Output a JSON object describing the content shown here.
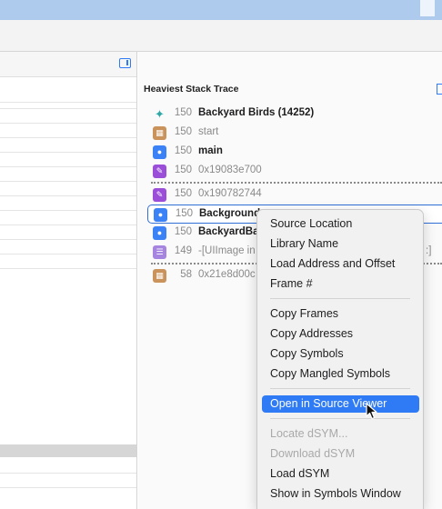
{
  "panel": {
    "title": "Heaviest Stack Trace"
  },
  "frames": [
    {
      "icon": "hummingbird-icon",
      "count": "150",
      "name": "Backyard Birds (14252)",
      "style": "bold"
    },
    {
      "icon": "library-icon",
      "count": "150",
      "name": "start",
      "style": "dim"
    },
    {
      "icon": "user-icon",
      "count": "150",
      "name": "main",
      "style": "bold"
    },
    {
      "icon": "purple-pen-icon",
      "count": "150",
      "name": "0x19083e700",
      "style": "dim"
    },
    {
      "icon": "purple-pen-icon",
      "count": "150",
      "name": "0x190782744",
      "style": "dim"
    },
    {
      "icon": "user-icon",
      "count": "150",
      "name": "Background",
      "style": "bold"
    },
    {
      "icon": "user-icon",
      "count": "150",
      "name": "BackyardBa",
      "style": "bold"
    },
    {
      "icon": "layers-icon",
      "count": "149",
      "name": "-[UIImage in",
      "style": "dim",
      "trail": ":]"
    },
    {
      "icon": "library-icon",
      "count": "58",
      "name": "0x21e8d00c",
      "style": "dim"
    }
  ],
  "context_menu": {
    "groups": [
      [
        "Source Location",
        "Library Name",
        "Load Address and Offset",
        "Frame #"
      ],
      [
        "Copy Frames",
        "Copy Addresses",
        "Copy Symbols",
        "Copy Mangled Symbols"
      ],
      [
        "Open in Source Viewer"
      ],
      [
        "Locate dSYM...",
        "Download dSYM",
        "Load dSYM",
        "Show in Symbols Window"
      ]
    ],
    "highlighted": "Open in Source Viewer",
    "disabled": [
      "Locate dSYM...",
      "Download dSYM"
    ]
  },
  "colors": {
    "accent": "#2f7bf5",
    "selection_border": "#2f6fd6",
    "user_icon": "#3b82f6",
    "library_icon": "#c9935b",
    "purple_icon": "#9b4fd8"
  }
}
